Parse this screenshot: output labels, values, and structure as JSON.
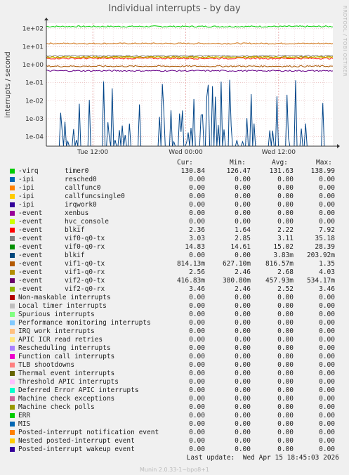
{
  "title": "Individual interrupts - by day",
  "side_label": "RRDTOOL / TOBI OETIKER",
  "footer": "Munin 2.0.33-1~bpo8+1",
  "last_update": "Last update:  Wed Apr 15 18:45:03 2026",
  "chart_data": {
    "type": "line",
    "ylabel": "interrupts / second",
    "yscale": "log",
    "ylim": [
      3e-05,
      200
    ],
    "y_ticks": [
      "1e-04",
      "1e-03",
      "1e-02",
      "1e-01",
      "1e+00",
      "1e+01",
      "1e+02"
    ],
    "x_ticks": [
      "Tue 12:00",
      "Wed 00:00",
      "Wed 12:00"
    ],
    "grid": true,
    "series": [
      {
        "name": "timer0",
        "color": "#00cc00",
        "level": 131.63
      },
      {
        "name": "vif0-q0-rx",
        "color": "#cc6600",
        "level": 15.02
      },
      {
        "name": "vif0-q0-tx",
        "color": "#888888",
        "level": 3.11
      },
      {
        "name": "vif1-q0-rx",
        "color": "#aa8800",
        "level": 2.68
      },
      {
        "name": "vif2-q0-rx",
        "color": "#cccc00",
        "level": 2.52
      },
      {
        "name": "blkif",
        "color": "#ff2020",
        "level": 2.22
      },
      {
        "name": "vif1-q0-tx",
        "color": "#aa5500",
        "level": 0.81657
      },
      {
        "name": "vif2-q0-tx",
        "color": "#660088",
        "level": 0.45793
      },
      {
        "name": "blkif",
        "color": "#004488",
        "level": 0.00383
      }
    ]
  },
  "legend": {
    "headers": {
      "cur": "Cur:",
      "min": "Min:",
      "avg": "Avg:",
      "max": "Max:"
    },
    "rows": [
      {
        "color": "#00cc00",
        "type": "-virq",
        "name": "timer0",
        "cur": "130.84",
        "min": "126.47",
        "avg": "131.63",
        "max": "138.99"
      },
      {
        "color": "#0066b3",
        "type": "-ipi",
        "name": "resched0",
        "cur": "0.00",
        "min": "0.00",
        "avg": "0.00",
        "max": "0.00"
      },
      {
        "color": "#ff8000",
        "type": "-ipi",
        "name": "callfunc0",
        "cur": "0.00",
        "min": "0.00",
        "avg": "0.00",
        "max": "0.00"
      },
      {
        "color": "#ffcc00",
        "type": "-ipi",
        "name": "callfuncsingle0",
        "cur": "0.00",
        "min": "0.00",
        "avg": "0.00",
        "max": "0.00"
      },
      {
        "color": "#330099",
        "type": "-ipi",
        "name": "irqwork0",
        "cur": "0.00",
        "min": "0.00",
        "avg": "0.00",
        "max": "0.00"
      },
      {
        "color": "#990099",
        "type": "-event",
        "name": "xenbus",
        "cur": "0.00",
        "min": "0.00",
        "avg": "0.00",
        "max": "0.00"
      },
      {
        "color": "#ccff00",
        "type": "-event",
        "name": "hvc_console",
        "cur": "0.00",
        "min": "0.00",
        "avg": "0.00",
        "max": "0.00"
      },
      {
        "color": "#ff0000",
        "type": "-event",
        "name": "blkif",
        "cur": "2.36",
        "min": "1.64",
        "avg": "2.22",
        "max": "7.92"
      },
      {
        "color": "#808080",
        "type": "-event",
        "name": "vif0-q0-tx",
        "cur": "3.03",
        "min": "2.85",
        "avg": "3.11",
        "max": "35.18"
      },
      {
        "color": "#008f00",
        "type": "-event",
        "name": "vif0-q0-rx",
        "cur": "14.83",
        "min": "14.61",
        "avg": "15.02",
        "max": "28.39"
      },
      {
        "color": "#00487d",
        "type": "-event",
        "name": "blkif",
        "cur": "0.00",
        "min": "0.00",
        "avg": "3.83m",
        "max": "203.92m"
      },
      {
        "color": "#b35a00",
        "type": "-event",
        "name": "vif1-q0-tx",
        "cur": "814.13m",
        "min": "627.10m",
        "avg": "816.57m",
        "max": "1.35"
      },
      {
        "color": "#b38f00",
        "type": "-event",
        "name": "vif1-q0-rx",
        "cur": "2.56",
        "min": "2.46",
        "avg": "2.68",
        "max": "4.03"
      },
      {
        "color": "#6b006b",
        "type": "-event",
        "name": "vif2-q0-tx",
        "cur": "416.83m",
        "min": "380.80m",
        "avg": "457.93m",
        "max": "534.17m"
      },
      {
        "color": "#8fb300",
        "type": "-event",
        "name": "vif2-q0-rx",
        "cur": "3.46",
        "min": "2.46",
        "avg": "2.52",
        "max": "3.46"
      },
      {
        "color": "#b30000",
        "type": "Non-maskable interrupts",
        "name": "",
        "cur": "0.00",
        "min": "0.00",
        "avg": "0.00",
        "max": "0.00"
      },
      {
        "color": "#bebebe",
        "type": "Local timer interrupts",
        "name": "",
        "cur": "0.00",
        "min": "0.00",
        "avg": "0.00",
        "max": "0.00"
      },
      {
        "color": "#80ff80",
        "type": "Spurious interrupts",
        "name": "",
        "cur": "0.00",
        "min": "0.00",
        "avg": "0.00",
        "max": "0.00"
      },
      {
        "color": "#80c9ff",
        "type": "Performance monitoring interrupts",
        "name": "",
        "cur": "0.00",
        "min": "0.00",
        "avg": "0.00",
        "max": "0.00"
      },
      {
        "color": "#ffc080",
        "type": "IRQ work interrupts",
        "name": "",
        "cur": "0.00",
        "min": "0.00",
        "avg": "0.00",
        "max": "0.00"
      },
      {
        "color": "#ffe680",
        "type": "APIC ICR read retries",
        "name": "",
        "cur": "0.00",
        "min": "0.00",
        "avg": "0.00",
        "max": "0.00"
      },
      {
        "color": "#aa80ff",
        "type": "Rescheduling interrupts",
        "name": "",
        "cur": "0.00",
        "min": "0.00",
        "avg": "0.00",
        "max": "0.00"
      },
      {
        "color": "#ee00cc",
        "type": "Function call interrupts",
        "name": "",
        "cur": "0.00",
        "min": "0.00",
        "avg": "0.00",
        "max": "0.00"
      },
      {
        "color": "#ff8080",
        "type": "TLB shootdowns",
        "name": "",
        "cur": "0.00",
        "min": "0.00",
        "avg": "0.00",
        "max": "0.00"
      },
      {
        "color": "#666600",
        "type": "Thermal event interrupts",
        "name": "",
        "cur": "0.00",
        "min": "0.00",
        "avg": "0.00",
        "max": "0.00"
      },
      {
        "color": "#ffbfff",
        "type": "Threshold APIC interrupts",
        "name": "",
        "cur": "0.00",
        "min": "0.00",
        "avg": "0.00",
        "max": "0.00"
      },
      {
        "color": "#00ffcc",
        "type": "Deferred Error APIC interrupts",
        "name": "",
        "cur": "0.00",
        "min": "0.00",
        "avg": "0.00",
        "max": "0.00"
      },
      {
        "color": "#cc6699",
        "type": "Machine check exceptions",
        "name": "",
        "cur": "0.00",
        "min": "0.00",
        "avg": "0.00",
        "max": "0.00"
      },
      {
        "color": "#999900",
        "type": "Machine check polls",
        "name": "",
        "cur": "0.00",
        "min": "0.00",
        "avg": "0.00",
        "max": "0.00"
      },
      {
        "color": "#00cc00",
        "type": "ERR",
        "name": "",
        "cur": "0.00",
        "min": "0.00",
        "avg": "0.00",
        "max": "0.00"
      },
      {
        "color": "#0066b3",
        "type": "MIS",
        "name": "",
        "cur": "0.00",
        "min": "0.00",
        "avg": "0.00",
        "max": "0.00"
      },
      {
        "color": "#ff8000",
        "type": "Posted-interrupt notification event",
        "name": "",
        "cur": "0.00",
        "min": "0.00",
        "avg": "0.00",
        "max": "0.00"
      },
      {
        "color": "#ffcc00",
        "type": "Nested posted-interrupt event",
        "name": "",
        "cur": "0.00",
        "min": "0.00",
        "avg": "0.00",
        "max": "0.00"
      },
      {
        "color": "#330099",
        "type": "Posted-interrupt wakeup event",
        "name": "",
        "cur": "0.00",
        "min": "0.00",
        "avg": "0.00",
        "max": "0.00"
      }
    ]
  }
}
